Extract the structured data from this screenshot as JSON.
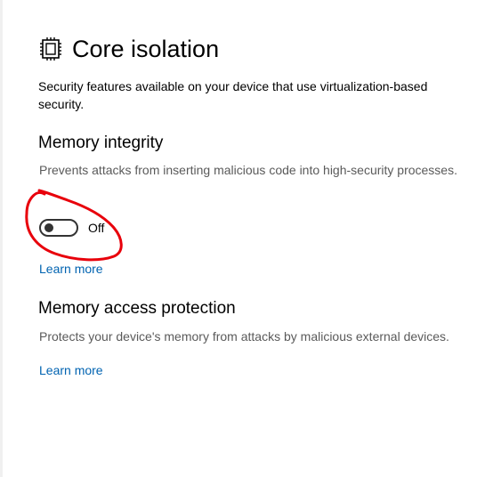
{
  "page": {
    "icon": "core-isolation-chip-icon",
    "title": "Core isolation",
    "description": "Security features available on your device that use virtualization-based security."
  },
  "memory_integrity": {
    "heading": "Memory integrity",
    "description": "Prevents attacks from inserting malicious code into high-security processes.",
    "toggle_state": "Off",
    "toggle_on": false,
    "learn_more": "Learn more"
  },
  "memory_access_protection": {
    "heading": "Memory access protection",
    "description": "Protects your device's memory from attacks by malicious external devices.",
    "learn_more": "Learn more"
  },
  "colors": {
    "link": "#0063b1",
    "annotation": "#e8000b",
    "secondary_text": "#5a5a5a"
  }
}
